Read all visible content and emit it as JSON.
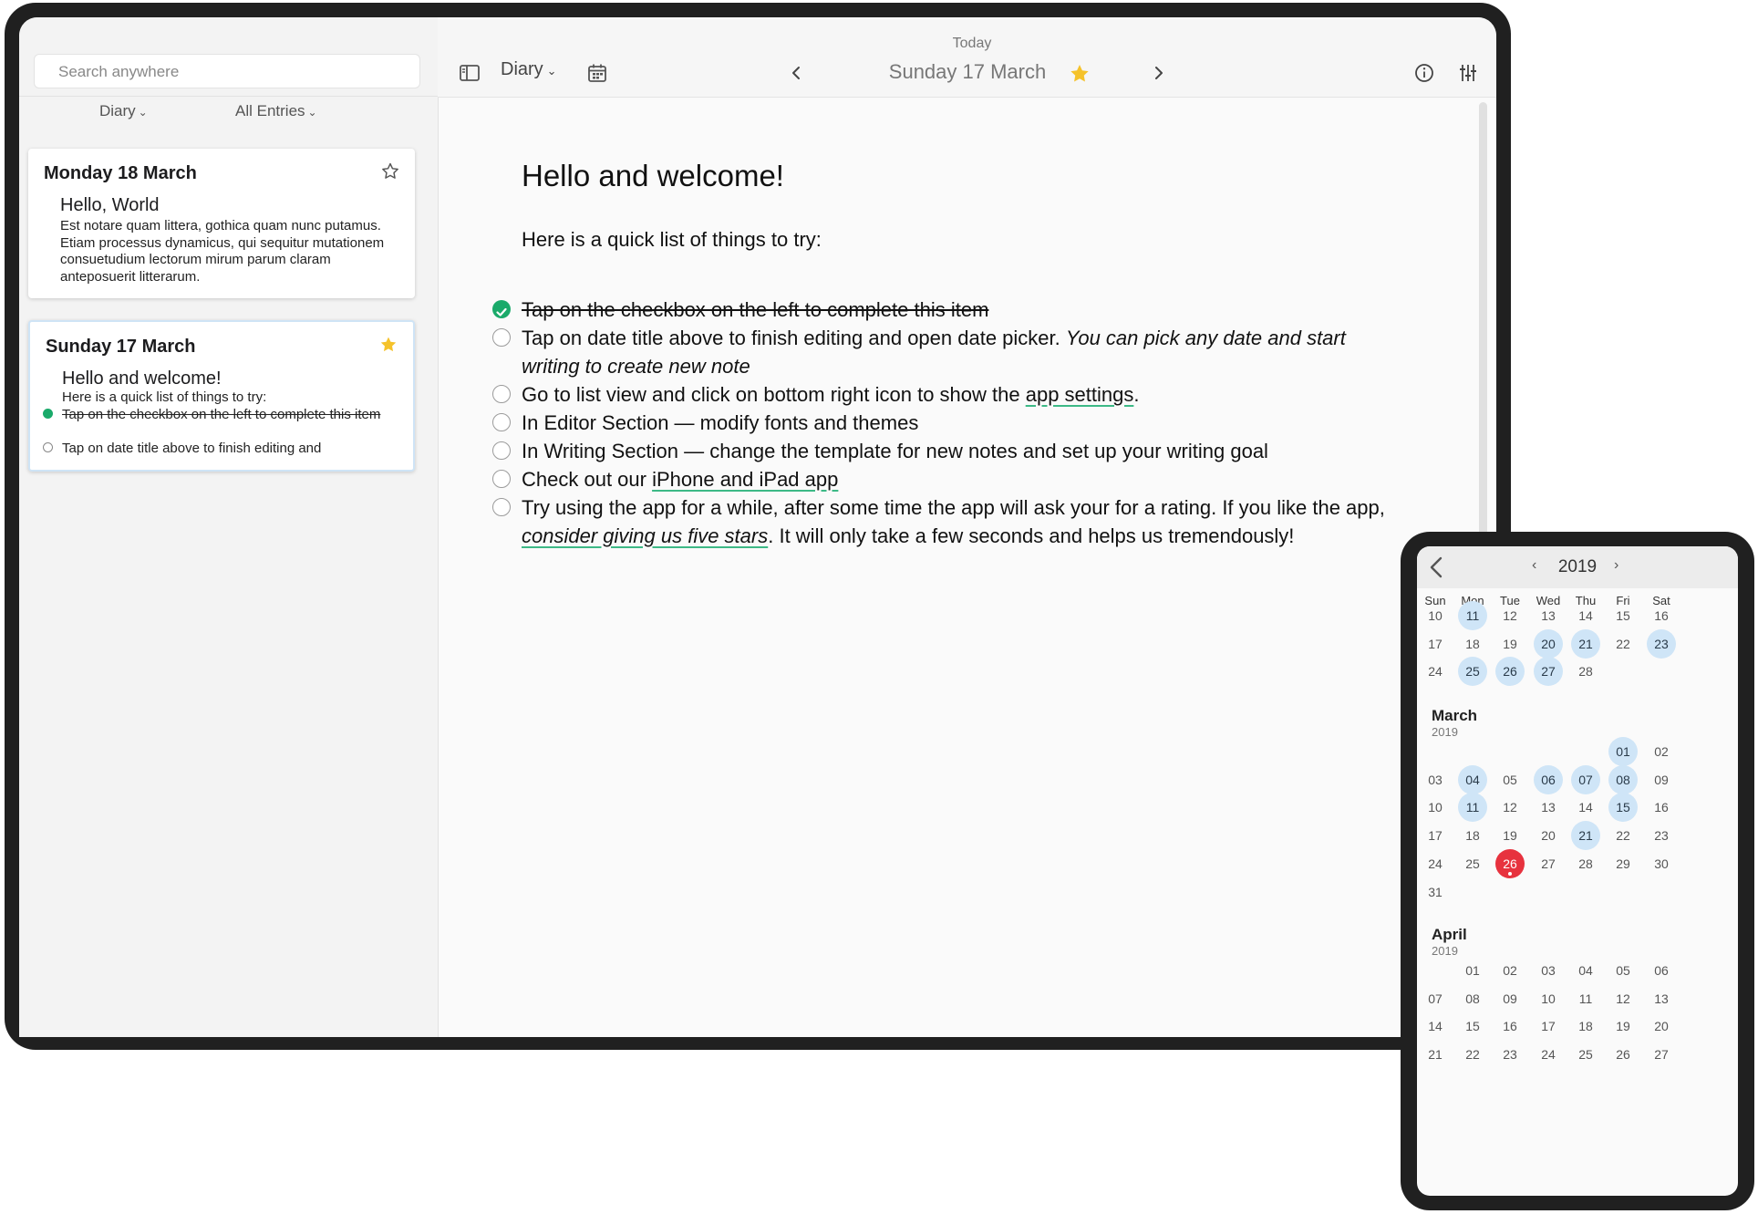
{
  "sidebar": {
    "search_placeholder": "Search anywhere",
    "filter_journal": "Diary",
    "filter_entries": "All Entries",
    "entries": [
      {
        "date": "Monday 18 March",
        "starred": false,
        "title": "Hello, World",
        "excerpt": "Est notare quam littera, gothica quam nunc putamus. Etiam processus dynamicus, qui sequitur mutationem consuetudium lectorum mirum parum claram anteposuerit litterarum."
      },
      {
        "date": "Sunday 17 March",
        "starred": true,
        "title": "Hello and welcome!",
        "excerpt": "Here is a quick list of things to try:",
        "tasks": [
          {
            "text": "Tap on the checkbox on the left to complete this item",
            "done": true
          },
          {
            "text": "Tap on date title above to finish editing and",
            "done": false
          }
        ]
      }
    ]
  },
  "toolbar": {
    "journal": "Diary",
    "today_label": "Today",
    "date_title": "Sunday 17 March",
    "starred": true
  },
  "editor": {
    "heading": "Hello and welcome!",
    "intro": "Here is a quick list of things to try:",
    "tasks": [
      {
        "done": true,
        "text": "Tap on the checkbox on the left to complete this item"
      },
      {
        "done": false,
        "text_a": "Tap on date title above to finish editing and open date picker. ",
        "text_b": "You can pick any date and start writing to create new note"
      },
      {
        "done": false,
        "text_a": "Go to list view and click on bottom right icon to show the ",
        "link": "app settings",
        "text_b": "."
      },
      {
        "done": false,
        "text": "In Editor Section — modify fonts and themes"
      },
      {
        "done": false,
        "text": "In Writing Section — change the template for new notes and set up your writing goal"
      },
      {
        "done": false,
        "text_a": "Check out our ",
        "link": "iPhone and iPad app"
      },
      {
        "done": false,
        "text_a": "Try using the app for a while, after some time the app will ask your for a rating. If you like the app, ",
        "link": "consider giving us five stars",
        "text_b": ". It will only take a few seconds and helps us tremendously!"
      }
    ]
  },
  "calendar": {
    "year": "2019",
    "weekdays": [
      "Sun",
      "Mon",
      "Tue",
      "Wed",
      "Thu",
      "Fri",
      "Sat"
    ],
    "feb_weeks": [
      [
        "10",
        "11",
        "12",
        "13",
        "14",
        "15",
        "16"
      ],
      [
        "17",
        "18",
        "19",
        "20",
        "21",
        "22",
        "23"
      ],
      [
        "24",
        "25",
        "26",
        "27",
        "28",
        "",
        ""
      ]
    ],
    "feb_highlighted": [
      "11",
      "20",
      "21",
      "23",
      "25",
      "26",
      "27"
    ],
    "march": {
      "name": "March",
      "year": "2019",
      "weeks": [
        [
          "",
          "",
          "",
          "",
          "",
          "01",
          "02"
        ],
        [
          "03",
          "04",
          "05",
          "06",
          "07",
          "08",
          "09"
        ],
        [
          "10",
          "11",
          "12",
          "13",
          "14",
          "15",
          "16"
        ],
        [
          "17",
          "18",
          "19",
          "20",
          "21",
          "22",
          "23"
        ],
        [
          "24",
          "25",
          "26",
          "27",
          "28",
          "29",
          "30"
        ],
        [
          "31",
          "",
          "",
          "",
          "",
          "",
          ""
        ]
      ],
      "highlighted": [
        "01",
        "04",
        "06",
        "07",
        "08",
        "11",
        "15",
        "21"
      ],
      "today": "26"
    },
    "april": {
      "name": "April",
      "year": "2019",
      "weeks": [
        [
          "",
          "01",
          "02",
          "03",
          "04",
          "05",
          "06"
        ],
        [
          "07",
          "08",
          "09",
          "10",
          "11",
          "12",
          "13"
        ],
        [
          "14",
          "15",
          "16",
          "17",
          "18",
          "19",
          "20"
        ],
        [
          "21",
          "22",
          "23",
          "24",
          "25",
          "26",
          "27"
        ]
      ]
    }
  },
  "colors": {
    "accent_green": "#1aaa6a",
    "star_yellow": "#f5c22b",
    "highlight_blue": "#cfe5f7",
    "today_red": "#e7323e"
  }
}
